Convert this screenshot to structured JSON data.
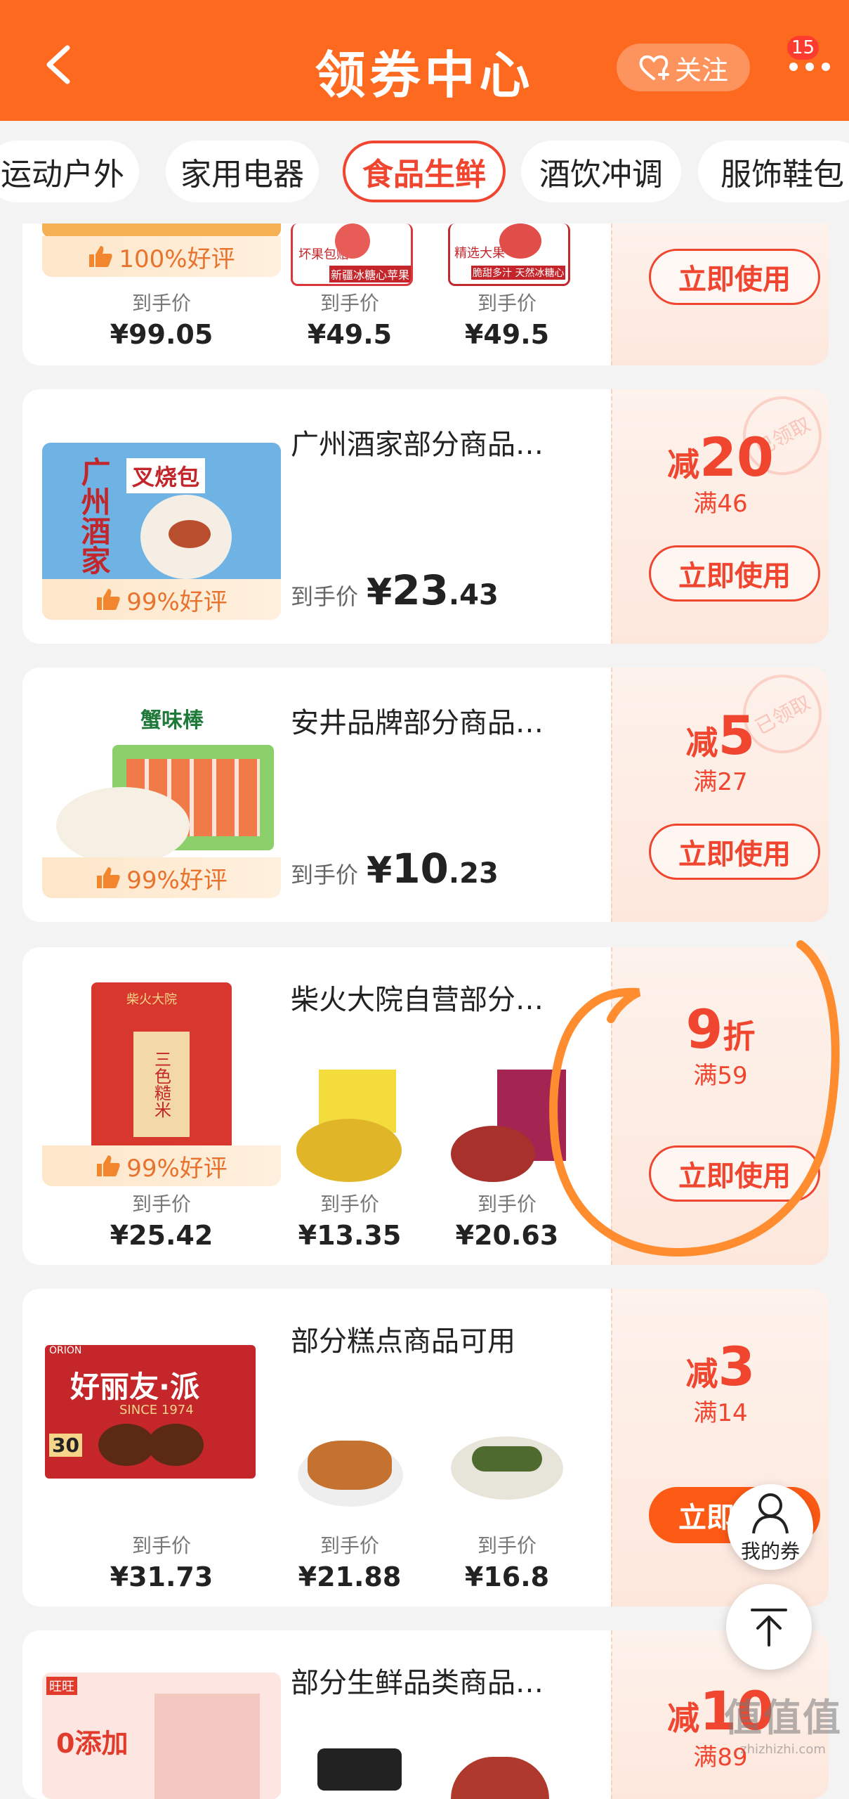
{
  "header": {
    "title": "领券中心",
    "follow_label": "关注",
    "badge_count": "15"
  },
  "tabs": [
    {
      "label": "运动户外",
      "active": false
    },
    {
      "label": "家用电器",
      "active": false
    },
    {
      "label": "食品生鲜",
      "active": true
    },
    {
      "label": "酒饮冲调",
      "active": false
    },
    {
      "label": "服饰鞋包",
      "active": false
    }
  ],
  "cards": [
    {
      "rating": "100%好评",
      "items": [
        {
          "label": "到手价",
          "price": "¥99.05"
        },
        {
          "label": "到手价",
          "price": "¥49.5"
        },
        {
          "label": "到手价",
          "price": "¥49.5"
        }
      ],
      "img_texts": [
        "坏果包赔",
        "新疆冰糖心苹果",
        "精选大果",
        "脆甜多汁 天然冰糖心"
      ],
      "button": "立即使用"
    },
    {
      "shop": "广州酒家部分商品…",
      "rating": "99%好评",
      "price_prefix": "到手价",
      "price_cur": "¥",
      "price_int": "23",
      "price_dec": ".43",
      "discount_pre": "减",
      "discount_big": "20",
      "condition": "满46",
      "stamp": "已领取",
      "button": "立即使用",
      "img_texts": [
        "叉烧包",
        "广州酒家"
      ]
    },
    {
      "shop": "安井品牌部分商品…",
      "rating": "99%好评",
      "price_prefix": "到手价",
      "price_cur": "¥",
      "price_int": "10",
      "price_dec": ".23",
      "discount_pre": "减",
      "discount_big": "5",
      "condition": "满27",
      "stamp": "已领取",
      "button": "立即使用",
      "img_texts": [
        "蟹味棒"
      ]
    },
    {
      "shop": "柴火大院自营部分…",
      "rating": "99%好评",
      "discount_big": "9",
      "discount_post": "折",
      "condition": "满59",
      "button": "立即使用",
      "items": [
        {
          "label": "到手价",
          "price": "¥25.42"
        },
        {
          "label": "到手价",
          "price": "¥13.35"
        },
        {
          "label": "到手价",
          "price": "¥20.63"
        }
      ],
      "img_texts": [
        "三色糙米",
        "柴火大院"
      ]
    },
    {
      "shop": "部分糕点商品可用",
      "discount_pre": "减",
      "discount_big": "3",
      "condition": "满14",
      "button": "立即使用",
      "items": [
        {
          "label": "到手价",
          "price": "¥31.73"
        },
        {
          "label": "到手价",
          "price": "¥21.88"
        },
        {
          "label": "到手价",
          "price": "¥16.8"
        }
      ],
      "img_texts": [
        "好丽友·派",
        "SINCE 1974",
        "30",
        "ORION"
      ]
    },
    {
      "shop": "部分生鲜品类商品…",
      "discount_pre": "减",
      "discount_big": "10",
      "condition": "满89",
      "img_texts": [
        "0添加",
        "旺旺"
      ]
    }
  ],
  "floating": {
    "my_coupons_label": "我的券"
  },
  "watermark": {
    "glyphs": "值值值",
    "url": "zhizhizhi.com"
  },
  "colors": {
    "header": "#fd6a1f",
    "accent": "#f0452f",
    "circle": "#ff8c2e"
  }
}
